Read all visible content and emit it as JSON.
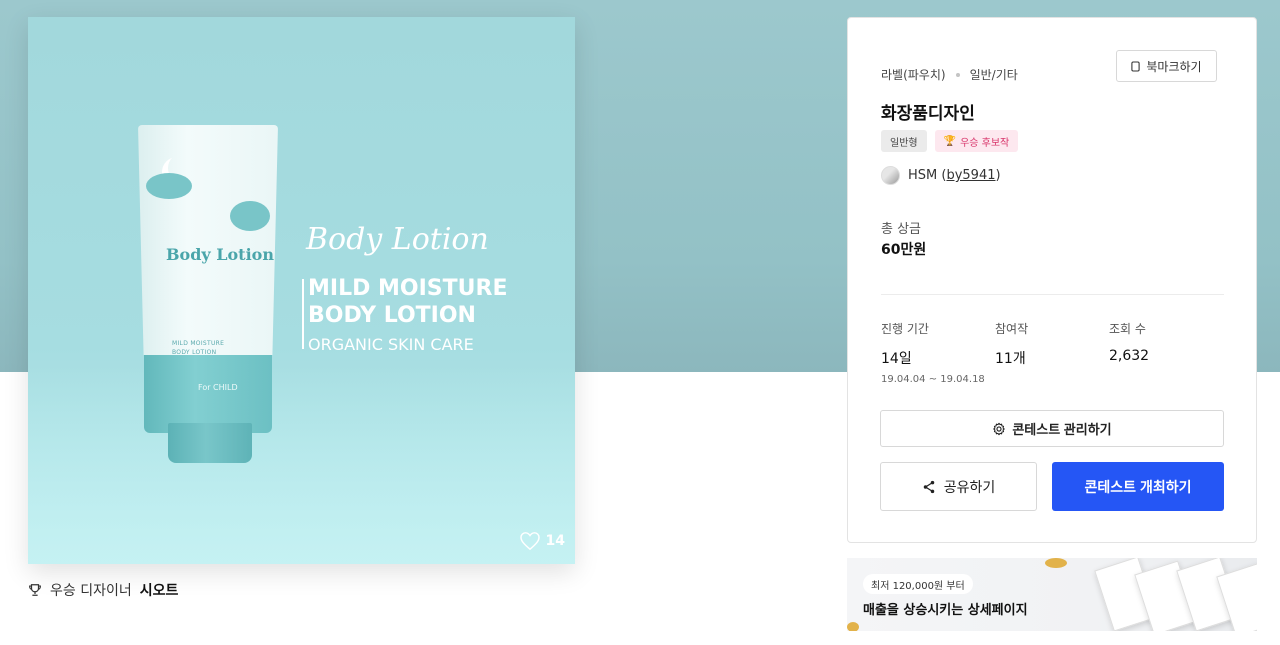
{
  "product": {
    "ad_title": "Body Lotion",
    "ad_headline_1": "MILD MOISTURE",
    "ad_headline_2": "BODY LOTION",
    "ad_subline": "ORGANIC SKIN CARE",
    "tube_brand": "Body Lotion",
    "tube_small_1": "MILD MOISTURE",
    "tube_small_2": "BODY LOTION",
    "tube_for": "For CHILD",
    "likes": "14"
  },
  "designer": {
    "prefix": "우승 디자이너",
    "name": "시오트"
  },
  "contest": {
    "category_main": "라벨(파우치)",
    "category_sub": "일반/기타",
    "bookmark_label": "북마크하기",
    "title": "화장품디자인",
    "tag_type": "일반형",
    "tag_award": "우승 후보작",
    "author_name": "HSM",
    "author_id": "by5941",
    "prize_label": "총 상금",
    "prize_value": "60만원",
    "stats": {
      "period_label": "진행 기간",
      "period_value": "14일",
      "period_range": "19.04.04 ~ 19.04.18",
      "entries_label": "참여작",
      "entries_value": "11개",
      "views_label": "조회 수",
      "views_value": "2,632"
    },
    "manage_label": "콘테스트 관리하기",
    "share_label": "공유하기",
    "host_label": "콘테스트 개최하기"
  },
  "banner": {
    "badge": "최저 120,000원 부터",
    "text": "매출을 상승시키는 상세페이지"
  },
  "colors": {
    "accent": "#2556f5",
    "hero_bg": "#9cc8cd",
    "award_tag": "#d8346a"
  }
}
